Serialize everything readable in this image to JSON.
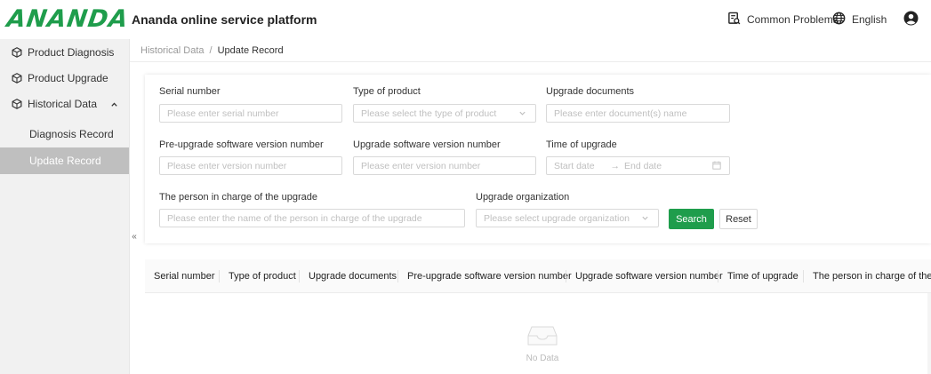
{
  "header": {
    "logo_text": "ANANDA",
    "title": "Ananda online service platform",
    "common_problems": "Common Problems",
    "language": "English",
    "brand_color": "#1f9d4c"
  },
  "sidebar": {
    "items": [
      {
        "label": "Product Diagnosis",
        "icon": "cube-icon"
      },
      {
        "label": "Product Upgrade",
        "icon": "cube-icon"
      },
      {
        "label": "Historical Data",
        "icon": "cube-icon",
        "expanded": true
      },
      {
        "label": "Diagnosis Record"
      },
      {
        "label": "Update Record",
        "active": true
      }
    ],
    "collapse_glyph": "«"
  },
  "breadcrumb": {
    "parent": "Historical Data",
    "separator": "/",
    "current": "Update Record"
  },
  "filters": {
    "serial_number": {
      "label": "Serial number",
      "placeholder": "Please enter serial number"
    },
    "product_type": {
      "label": "Type of product",
      "placeholder": "Please select the type of product"
    },
    "upgrade_documents": {
      "label": "Upgrade documents",
      "placeholder": "Please enter document(s) name"
    },
    "pre_version": {
      "label": "Pre-upgrade software version number",
      "placeholder": "Please enter version number"
    },
    "upgrade_version": {
      "label": "Upgrade software version number",
      "placeholder": "Please enter version number"
    },
    "upgrade_time": {
      "label": "Time of upgrade",
      "start_placeholder": "Start date",
      "arrow": "→",
      "end_placeholder": "End date"
    },
    "person": {
      "label": "The person in charge of the upgrade",
      "placeholder": "Please enter the name of the person in charge of the upgrade"
    },
    "organization": {
      "label": "Upgrade organization",
      "placeholder": "Please select upgrade organization"
    },
    "search_label": "Search",
    "reset_label": "Reset"
  },
  "table": {
    "columns": [
      "Serial number",
      "Type of product",
      "Upgrade documents",
      "Pre-upgrade software version number",
      "Upgrade software version number",
      "Time of upgrade",
      "The person in charge of the up"
    ],
    "empty_text": "No Data"
  }
}
